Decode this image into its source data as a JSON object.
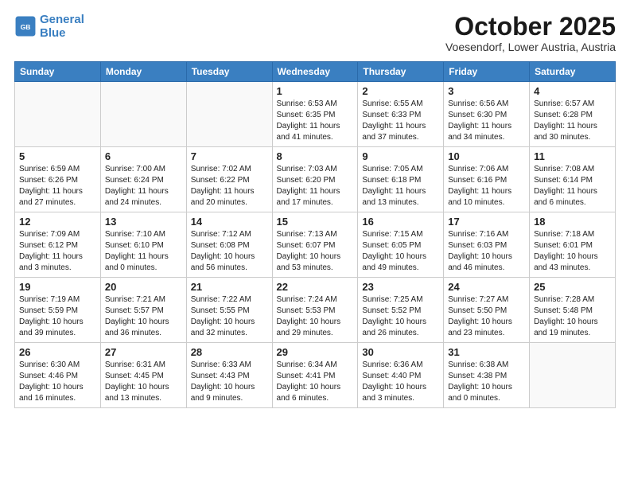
{
  "header": {
    "logo_line1": "General",
    "logo_line2": "Blue",
    "month": "October 2025",
    "location": "Voesendorf, Lower Austria, Austria"
  },
  "weekdays": [
    "Sunday",
    "Monday",
    "Tuesday",
    "Wednesday",
    "Thursday",
    "Friday",
    "Saturday"
  ],
  "weeks": [
    [
      {
        "day": "",
        "empty": true
      },
      {
        "day": "",
        "empty": true
      },
      {
        "day": "",
        "empty": true
      },
      {
        "day": "1",
        "sunrise": "6:53 AM",
        "sunset": "6:35 PM",
        "daylight": "11 hours and 41 minutes."
      },
      {
        "day": "2",
        "sunrise": "6:55 AM",
        "sunset": "6:33 PM",
        "daylight": "11 hours and 37 minutes."
      },
      {
        "day": "3",
        "sunrise": "6:56 AM",
        "sunset": "6:30 PM",
        "daylight": "11 hours and 34 minutes."
      },
      {
        "day": "4",
        "sunrise": "6:57 AM",
        "sunset": "6:28 PM",
        "daylight": "11 hours and 30 minutes."
      }
    ],
    [
      {
        "day": "5",
        "sunrise": "6:59 AM",
        "sunset": "6:26 PM",
        "daylight": "11 hours and 27 minutes."
      },
      {
        "day": "6",
        "sunrise": "7:00 AM",
        "sunset": "6:24 PM",
        "daylight": "11 hours and 24 minutes."
      },
      {
        "day": "7",
        "sunrise": "7:02 AM",
        "sunset": "6:22 PM",
        "daylight": "11 hours and 20 minutes."
      },
      {
        "day": "8",
        "sunrise": "7:03 AM",
        "sunset": "6:20 PM",
        "daylight": "11 hours and 17 minutes."
      },
      {
        "day": "9",
        "sunrise": "7:05 AM",
        "sunset": "6:18 PM",
        "daylight": "11 hours and 13 minutes."
      },
      {
        "day": "10",
        "sunrise": "7:06 AM",
        "sunset": "6:16 PM",
        "daylight": "11 hours and 10 minutes."
      },
      {
        "day": "11",
        "sunrise": "7:08 AM",
        "sunset": "6:14 PM",
        "daylight": "11 hours and 6 minutes."
      }
    ],
    [
      {
        "day": "12",
        "sunrise": "7:09 AM",
        "sunset": "6:12 PM",
        "daylight": "11 hours and 3 minutes."
      },
      {
        "day": "13",
        "sunrise": "7:10 AM",
        "sunset": "6:10 PM",
        "daylight": "11 hours and 0 minutes."
      },
      {
        "day": "14",
        "sunrise": "7:12 AM",
        "sunset": "6:08 PM",
        "daylight": "10 hours and 56 minutes."
      },
      {
        "day": "15",
        "sunrise": "7:13 AM",
        "sunset": "6:07 PM",
        "daylight": "10 hours and 53 minutes."
      },
      {
        "day": "16",
        "sunrise": "7:15 AM",
        "sunset": "6:05 PM",
        "daylight": "10 hours and 49 minutes."
      },
      {
        "day": "17",
        "sunrise": "7:16 AM",
        "sunset": "6:03 PM",
        "daylight": "10 hours and 46 minutes."
      },
      {
        "day": "18",
        "sunrise": "7:18 AM",
        "sunset": "6:01 PM",
        "daylight": "10 hours and 43 minutes."
      }
    ],
    [
      {
        "day": "19",
        "sunrise": "7:19 AM",
        "sunset": "5:59 PM",
        "daylight": "10 hours and 39 minutes."
      },
      {
        "day": "20",
        "sunrise": "7:21 AM",
        "sunset": "5:57 PM",
        "daylight": "10 hours and 36 minutes."
      },
      {
        "day": "21",
        "sunrise": "7:22 AM",
        "sunset": "5:55 PM",
        "daylight": "10 hours and 32 minutes."
      },
      {
        "day": "22",
        "sunrise": "7:24 AM",
        "sunset": "5:53 PM",
        "daylight": "10 hours and 29 minutes."
      },
      {
        "day": "23",
        "sunrise": "7:25 AM",
        "sunset": "5:52 PM",
        "daylight": "10 hours and 26 minutes."
      },
      {
        "day": "24",
        "sunrise": "7:27 AM",
        "sunset": "5:50 PM",
        "daylight": "10 hours and 23 minutes."
      },
      {
        "day": "25",
        "sunrise": "7:28 AM",
        "sunset": "5:48 PM",
        "daylight": "10 hours and 19 minutes."
      }
    ],
    [
      {
        "day": "26",
        "sunrise": "6:30 AM",
        "sunset": "4:46 PM",
        "daylight": "10 hours and 16 minutes."
      },
      {
        "day": "27",
        "sunrise": "6:31 AM",
        "sunset": "4:45 PM",
        "daylight": "10 hours and 13 minutes."
      },
      {
        "day": "28",
        "sunrise": "6:33 AM",
        "sunset": "4:43 PM",
        "daylight": "10 hours and 9 minutes."
      },
      {
        "day": "29",
        "sunrise": "6:34 AM",
        "sunset": "4:41 PM",
        "daylight": "10 hours and 6 minutes."
      },
      {
        "day": "30",
        "sunrise": "6:36 AM",
        "sunset": "4:40 PM",
        "daylight": "10 hours and 3 minutes."
      },
      {
        "day": "31",
        "sunrise": "6:38 AM",
        "sunset": "4:38 PM",
        "daylight": "10 hours and 0 minutes."
      },
      {
        "day": "",
        "empty": true
      }
    ]
  ]
}
